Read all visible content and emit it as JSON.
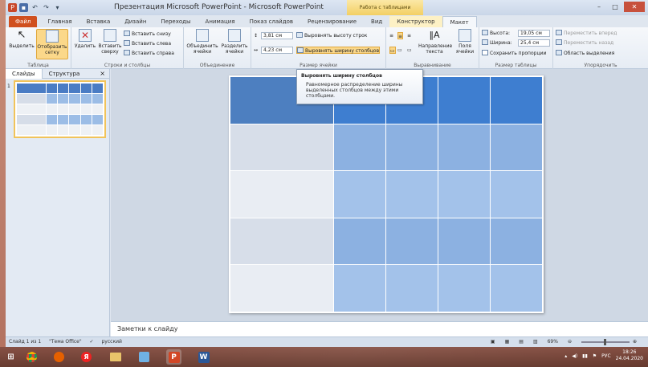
{
  "window": {
    "title": "Презентация Microsoft PowerPoint - Microsoft PowerPoint",
    "context_tools": "Работа с таблицами"
  },
  "tabs": [
    "Файл",
    "Главная",
    "Вставка",
    "Дизайн",
    "Переходы",
    "Анимация",
    "Показ слайдов",
    "Рецензирование",
    "Вид",
    "Конструктор",
    "Макет"
  ],
  "ribbon": {
    "groups": {
      "table": "Таблица",
      "rows_cols": "Строки и столбцы",
      "merge": "Объединение",
      "cell_size": "Размер ячейки",
      "alignment": "Выравнивание",
      "table_size": "Размер таблицы",
      "arrange": "Упорядочить"
    },
    "select": "Выделить",
    "gridlines_1": "Отобразить",
    "gridlines_2": "сетку",
    "delete": "Удалить",
    "insert_above_1": "Вставить",
    "insert_above_2": "сверху",
    "insert_below": "Вставить снизу",
    "insert_left": "Вставить слева",
    "insert_right": "Вставить справа",
    "merge_1": "Объединить",
    "merge_2": "ячейки",
    "split_1": "Разделить",
    "split_2": "ячейки",
    "height_val": "3,81 см",
    "width_val": "4,23 см",
    "dist_rows": "Выровнять высоту строк",
    "dist_cols": "Выровнять ширину столбцов",
    "direction_1": "Направление",
    "direction_2": "текста",
    "margins_1": "Поля",
    "margins_2": "ячейки",
    "tbl_height_label": "Высота:",
    "tbl_height_val": "19,05 см",
    "tbl_width_label": "Ширина:",
    "tbl_width_val": "25,4 см",
    "lock_ratio": "Сохранить пропорции",
    "bring_forward": "Переместить вперед",
    "send_backward": "Переместить назад",
    "selection_pane": "Область выделения"
  },
  "tooltip": {
    "title": "Выровнять ширину столбцов",
    "body": "Равномерное распределение ширины выделенных столбцов между этими столбцами."
  },
  "pane": {
    "tab_slides": "Слайды",
    "tab_outline": "Структура",
    "close": "×",
    "slide_number": "1"
  },
  "notes": "Заметки к слайду",
  "status": {
    "slide": "Слайд 1 из 1",
    "theme": "\"Тема Office\"",
    "lang": "русский",
    "zoom": "69%"
  },
  "taskbar": {
    "lang": "РУС",
    "time": "18:26",
    "date": "24.04.2020"
  }
}
